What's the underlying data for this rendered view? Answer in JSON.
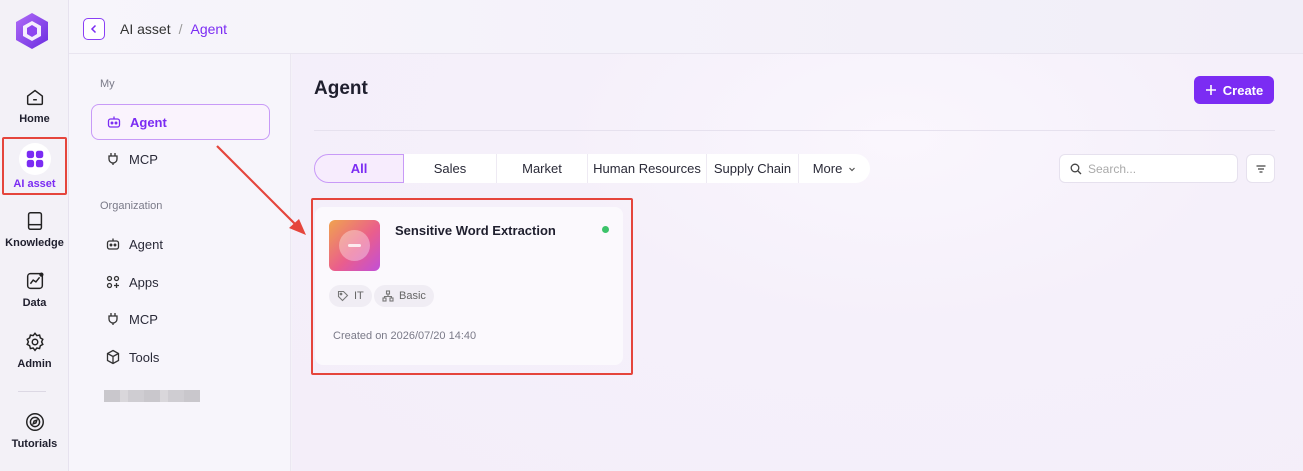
{
  "rail": {
    "items": [
      {
        "label": "Home",
        "icon": "home-icon"
      },
      {
        "label": "AI asset",
        "icon": "grid-icon",
        "active": true
      },
      {
        "label": "Knowledge",
        "icon": "book-icon"
      },
      {
        "label": "Data",
        "icon": "chart-icon"
      },
      {
        "label": "Admin",
        "icon": "gear-icon"
      },
      {
        "label": "Tutorials",
        "icon": "compass-icon"
      }
    ]
  },
  "breadcrumb": {
    "root": "AI asset",
    "separator": "/",
    "current": "Agent"
  },
  "sidebar": {
    "my_title": "My",
    "my_items": [
      {
        "label": "Agent",
        "icon": "robot-icon",
        "active": true
      },
      {
        "label": "MCP",
        "icon": "plug-icon"
      }
    ],
    "org_title": "Organization",
    "org_items": [
      {
        "label": "Agent",
        "icon": "robot-icon"
      },
      {
        "label": "Apps",
        "icon": "apps-icon"
      },
      {
        "label": "MCP",
        "icon": "plug-icon"
      },
      {
        "label": "Tools",
        "icon": "cube-icon"
      }
    ]
  },
  "main": {
    "title": "Agent",
    "create_label": "Create",
    "tabs": [
      {
        "label": "All",
        "active": true
      },
      {
        "label": "Sales"
      },
      {
        "label": "Market"
      },
      {
        "label": "Human Resources"
      },
      {
        "label": "Supply Chain"
      },
      {
        "label": "More"
      }
    ],
    "search_placeholder": "Search..."
  },
  "cards": [
    {
      "title": "Sensitive Word Extraction",
      "status": "online",
      "tags": [
        "IT",
        "Basic"
      ],
      "created": "Created on 2026/07/20 14:40"
    }
  ],
  "colors": {
    "accent": "#7b2cf3",
    "highlight": "#e5453c",
    "status_online": "#3cc36a"
  }
}
